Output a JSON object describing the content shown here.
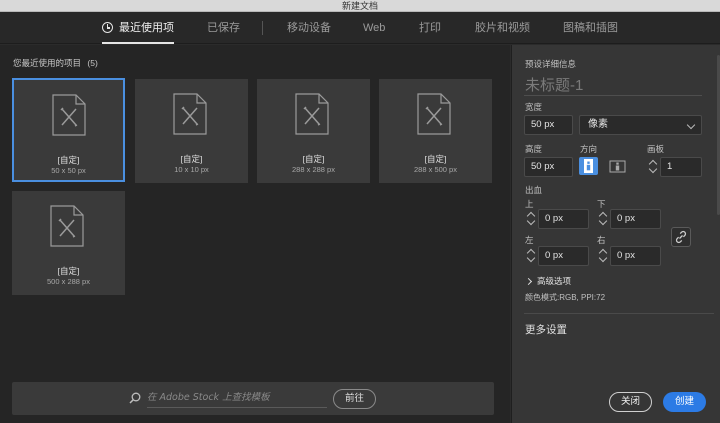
{
  "window": {
    "title": "新建文档"
  },
  "tabs": [
    {
      "label": "最近使用项",
      "active": true
    },
    {
      "label": "已保存",
      "active": false
    },
    {
      "label": "移动设备",
      "active": false
    },
    {
      "label": "Web",
      "active": false
    },
    {
      "label": "打印",
      "active": false
    },
    {
      "label": "胶片和视频",
      "active": false
    },
    {
      "label": "图稿和插图",
      "active": false
    }
  ],
  "recent": {
    "title": "您最近使用的项目",
    "count": "(5)",
    "items": [
      {
        "name": "[自定]",
        "size": "50 x 50 px",
        "selected": true
      },
      {
        "name": "[自定]",
        "size": "10 x 10 px",
        "selected": false
      },
      {
        "name": "[自定]",
        "size": "288 x 288 px",
        "selected": false
      },
      {
        "name": "[自定]",
        "size": "288 x 500 px",
        "selected": false
      },
      {
        "name": "[自定]",
        "size": "500 x 288 px",
        "selected": false
      }
    ]
  },
  "search": {
    "placeholder": "在 Adobe Stock 上查找模板",
    "go_label": "前往"
  },
  "preset": {
    "section_title": "预设详细信息",
    "name": "未标题-1",
    "width_label": "宽度",
    "width_value": "50 px",
    "unit": "像素",
    "height_label": "高度",
    "height_value": "50 px",
    "orientation_label": "方向",
    "orientation": "portrait",
    "artboards_label": "画板",
    "artboards_value": "1",
    "bleed_label": "出血",
    "bleed": {
      "top_label": "上",
      "top_value": "0 px",
      "bottom_label": "下",
      "bottom_value": "0 px",
      "left_label": "左",
      "left_value": "0 px",
      "right_label": "右",
      "right_value": "0 px"
    },
    "advanced_label": "高级选项",
    "color_mode": "颜色模式:RGB, PPI:72",
    "more_settings": "更多设置"
  },
  "actions": {
    "close_label": "关闭",
    "create_label": "创建"
  },
  "colors": {
    "accent": "#2c7be5",
    "selection": "#4a8fe0"
  }
}
